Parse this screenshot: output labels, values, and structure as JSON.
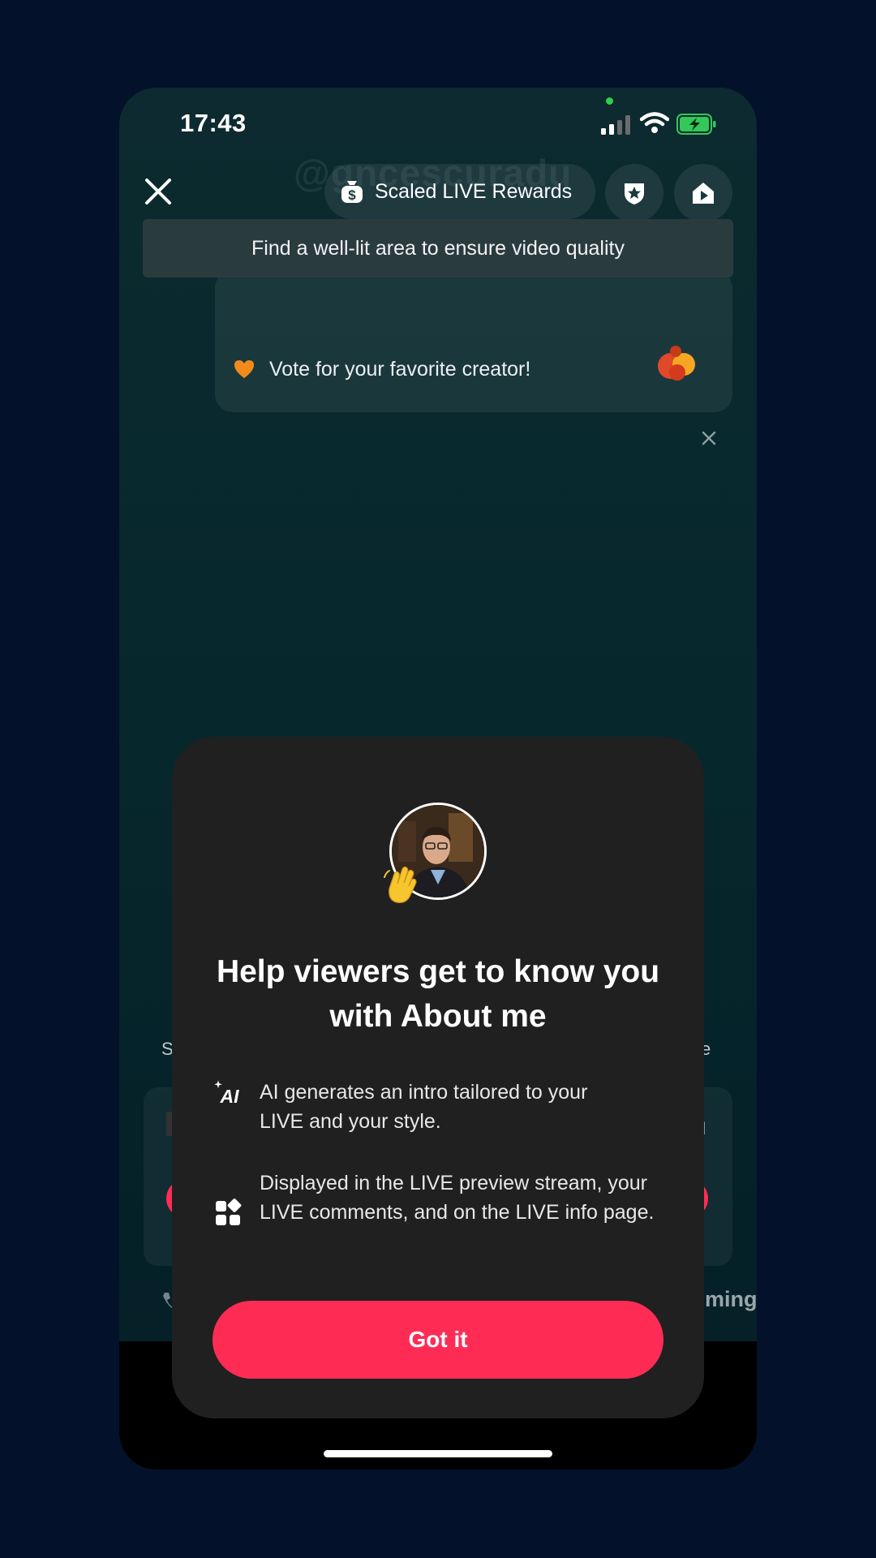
{
  "status_bar": {
    "time": "17:43"
  },
  "header": {
    "watermark": "@gncescuradu",
    "rewards_label": "Scaled LIVE Rewards"
  },
  "banners": {
    "tip": "Find a well-lit area to ensure video quality",
    "vote": "Vote for your favorite creator!"
  },
  "background_fragments": {
    "left_s": "S",
    "right_e": "e",
    "right_bar": "I",
    "bottom_right": "ming"
  },
  "modal": {
    "title": "Help viewers get to know you with About me",
    "features": [
      {
        "icon": "ai-sparkle-icon",
        "icon_text": "AI",
        "text": "AI generates an intro tailored to your LIVE and your style."
      },
      {
        "icon": "widgets-icon",
        "text": "Displayed in the LIVE preview stream, your LIVE comments, and on the LIVE info page."
      }
    ],
    "button_label": "Got it"
  },
  "colors": {
    "accent": "#fe2c55",
    "modal_bg": "#202020",
    "page_bg": "#03112b",
    "battery": "#34c759"
  }
}
